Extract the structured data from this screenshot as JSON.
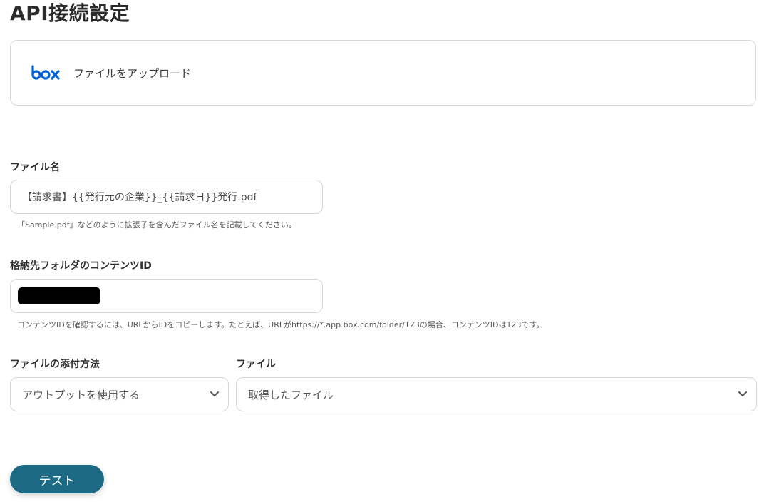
{
  "page": {
    "title": "API接続設定"
  },
  "app": {
    "logo_text": "box",
    "action_label": "ファイルをアップロード",
    "logo_color": "#0061D5"
  },
  "fields": {
    "file_name": {
      "label": "ファイル名",
      "value": "【請求書】{{発行元の企業}}_{{請求日}}発行.pdf",
      "help": "「Sample.pdf」などのように拡張子を含んだファイル名を記載してください。"
    },
    "folder_id": {
      "label": "格納先フォルダのコンテンツID",
      "value_redacted": true,
      "help": "コンテンツIDを確認するには、URLからIDをコピーします。たとえば、URLがhttps://*.app.box.com/folder/123の場合、コンテンツIDは123です。"
    },
    "attach_method": {
      "label": "ファイルの添付方法",
      "selected": "アウトプットを使用する"
    },
    "file": {
      "label": "ファイル",
      "selected": "取得したファイル"
    }
  },
  "actions": {
    "test_label": "テスト",
    "test_color": "#1D6A85"
  }
}
